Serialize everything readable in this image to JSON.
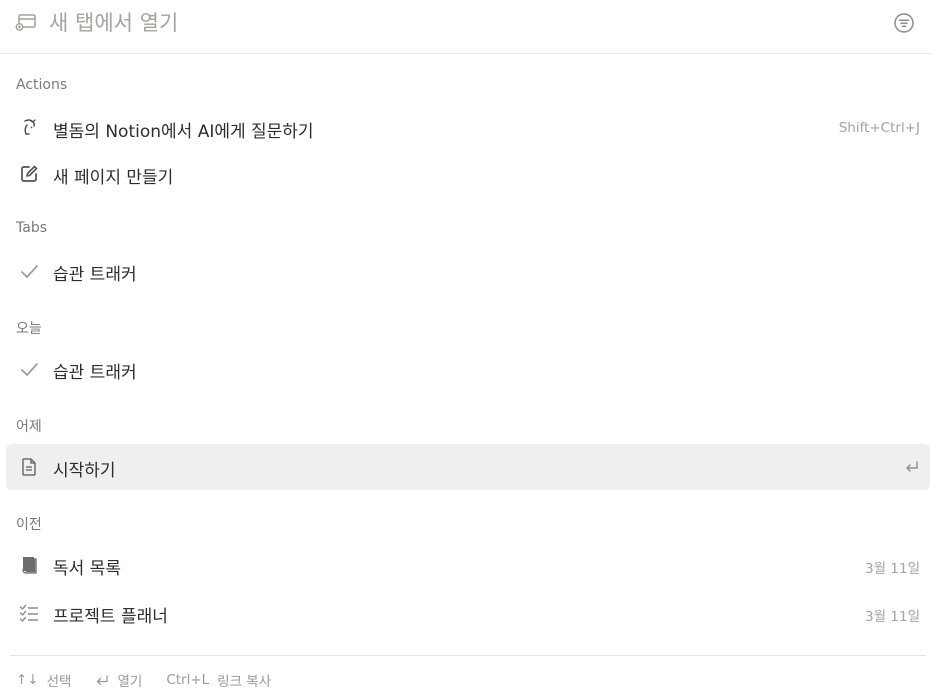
{
  "search": {
    "placeholder": "새 탭에서 열기"
  },
  "sections": {
    "actions": "Actions",
    "tabs": "Tabs",
    "today": "오늘",
    "yesterday": "어제",
    "earlier": "이전"
  },
  "rows": {
    "ask_ai": {
      "label": "별돔의 Notion에서 AI에게 질문하기",
      "shortcut": "Shift+Ctrl+J",
      "icon": "ai-face-icon"
    },
    "new_page": {
      "label": "새 페이지 만들기",
      "icon": "edit-icon"
    },
    "tab_habit": {
      "label": "습관 트래커",
      "icon": "checkmark-icon"
    },
    "today_habit": {
      "label": "습관 트래커",
      "icon": "checkmark-icon"
    },
    "getting_started": {
      "label": "시작하기",
      "icon": "document-icon",
      "selected": true
    },
    "reading_list": {
      "label": "독서 목록",
      "date": "3월 11일",
      "icon": "book-icon"
    },
    "project_planner": {
      "label": "프로젝트 플래너",
      "date": "3월 11일",
      "icon": "checklist-icon"
    }
  },
  "footer": {
    "select_key": "↑↓",
    "select_label": "선택",
    "open_label": "열기",
    "copy_key": "Ctrl+L",
    "copy_label": "링크 복사"
  },
  "colors": {
    "selected_bg": "#f0efed",
    "muted_text": "#7d7a75",
    "placeholder": "#a5a39e"
  }
}
